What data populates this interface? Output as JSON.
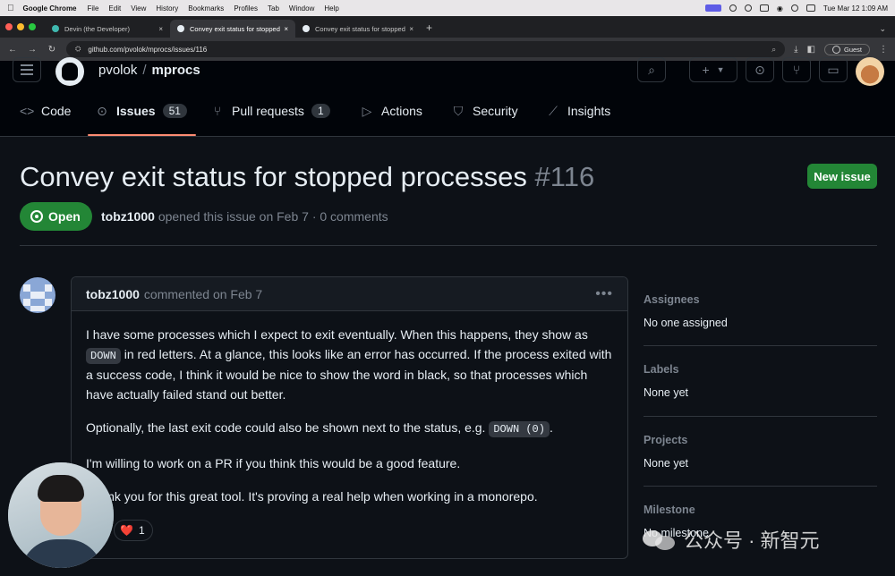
{
  "menubar": {
    "app_name": "Google Chrome",
    "items": [
      "File",
      "Edit",
      "View",
      "History",
      "Bookmarks",
      "Profiles",
      "Tab",
      "Window",
      "Help"
    ],
    "clock": "Tue Mar 12  1:09 AM"
  },
  "browser": {
    "tabs": [
      {
        "label": "Devin (the Developer)",
        "active": false
      },
      {
        "label": "Convey exit status for stopped",
        "active": true
      },
      {
        "label": "Convey exit status for stopped",
        "active": false
      }
    ],
    "url": "github.com/pvolok/mprocs/issues/116",
    "profile_label": "Guest"
  },
  "github": {
    "owner": "pvolok",
    "repo": "mprocs",
    "nav": [
      {
        "label": "Code",
        "icon": "code-icon",
        "count": null
      },
      {
        "label": "Issues",
        "icon": "issue-opened-icon",
        "count": "51"
      },
      {
        "label": "Pull requests",
        "icon": "git-pull-request-icon",
        "count": "1"
      },
      {
        "label": "Actions",
        "icon": "play-icon",
        "count": null
      },
      {
        "label": "Security",
        "icon": "shield-icon",
        "count": null
      },
      {
        "label": "Insights",
        "icon": "graph-icon",
        "count": null
      }
    ]
  },
  "issue": {
    "title": "Convey exit status for stopped processes",
    "number": "#116",
    "new_issue_label": "New issue",
    "state": "Open",
    "author": "tobz1000",
    "meta_rest": "opened this issue on Feb 7 · 0 comments"
  },
  "comment": {
    "author": "tobz1000",
    "action": "commented on Feb 7",
    "p1_a": "I have some processes which I expect to exit eventually. When this happens, they show as",
    "p1_code": "DOWN",
    "p1_b": "in red letters. At a glance, this looks like an error has occurred. If the process exited with a success code, I think it would be nice to show the word in black, so that processes which have actually failed stand out better.",
    "p2_a": "Optionally, the last exit code could also be shown next to the status, e.g.",
    "p2_code": "DOWN (0)",
    "p2_b": ".",
    "p3": "I'm willing to work on a PR if you think this would be a good feature.",
    "p4": "Thank you for this great tool. It's proving a real help when working in a monorepo.",
    "reaction_emoji": "❤️",
    "reaction_count": "1"
  },
  "sidebar": {
    "assignees_label": "Assignees",
    "assignees_value": "No one assigned",
    "labels_label": "Labels",
    "labels_value": "None yet",
    "projects_label": "Projects",
    "projects_value": "None yet",
    "milestone_label": "Milestone",
    "milestone_value": "No milestone"
  },
  "watermark": {
    "text": "公众号 · 新智元"
  },
  "colors": {
    "background": "#0d1117",
    "open_green": "#238636",
    "nav_underline": "#fd8c73",
    "muted": "#7d8590"
  }
}
